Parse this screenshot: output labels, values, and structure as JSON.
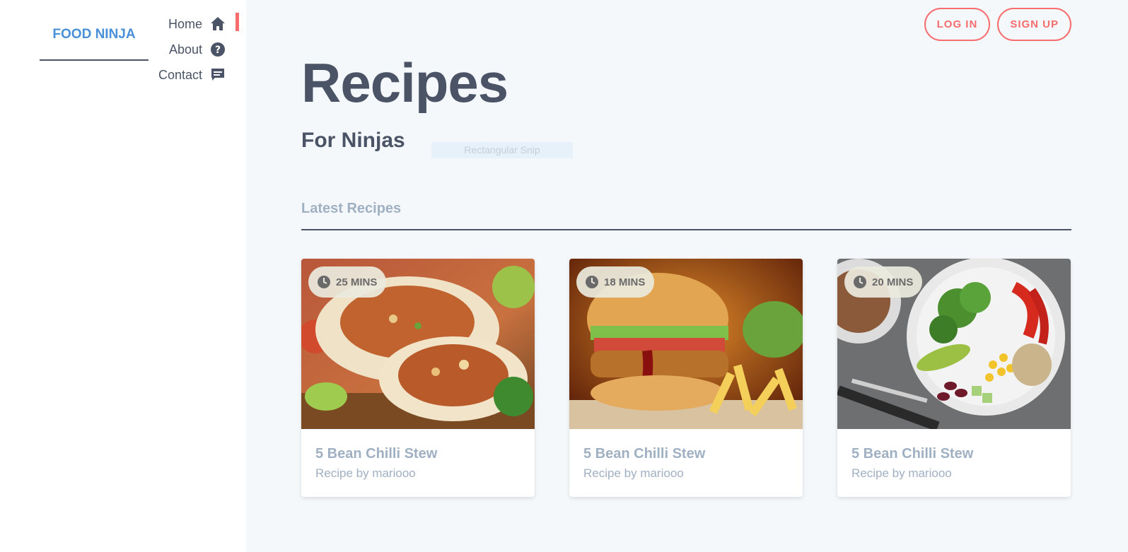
{
  "brand": {
    "name": "FOOD NINJA"
  },
  "nav": [
    {
      "label": "Home",
      "icon": "home-icon",
      "active": true
    },
    {
      "label": "About",
      "icon": "help-icon",
      "active": false
    },
    {
      "label": "Contact",
      "icon": "chat-icon",
      "active": false
    }
  ],
  "auth": {
    "login_label": "LOG IN",
    "signup_label": "SIGN UP"
  },
  "page": {
    "title": "Recipes",
    "subtitle": "For Ninjas",
    "snip_label": "Rectangular Snip"
  },
  "section": {
    "title": "Latest Recipes"
  },
  "recipes": [
    {
      "time": "25 MINS",
      "title": "5 Bean Chilli Stew",
      "author": "Recipe by mariooo",
      "image": "burrito"
    },
    {
      "time": "18 MINS",
      "title": "5 Bean Chilli Stew",
      "author": "Recipe by mariooo",
      "image": "burger"
    },
    {
      "time": "20 MINS",
      "title": "5 Bean Chilli Stew",
      "author": "Recipe by mariooo",
      "image": "salad-bowl"
    }
  ],
  "colors": {
    "accent": "#f76c6c",
    "brand": "#4a90d9",
    "text": "#4a5466",
    "muted": "#a0b0c3",
    "background": "#f5f8fb"
  }
}
